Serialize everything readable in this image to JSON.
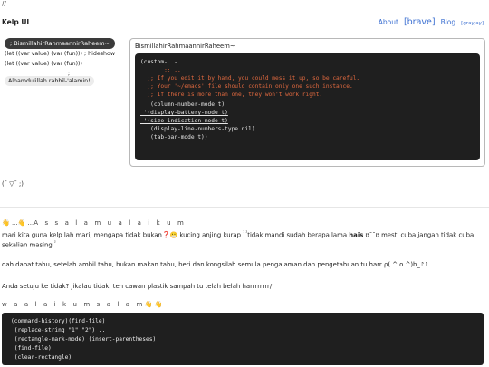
{
  "header": {
    "slashes": "//",
    "brand": "Kelp UI",
    "nav": {
      "about": "About",
      "brave": "[brave]",
      "blog": "Blog",
      "grayjay": "[grayjay]"
    }
  },
  "bubbles": {
    "title": "; BismillahirRahmaannirRaheem~",
    "line1": "(let ((var value) (var (fun))) ; hideshow",
    "line2": "(let ((var value) (var (fun)))",
    "semicolon": ";",
    "footer": "Alhamdulillah rabbil-'alamin!"
  },
  "card": {
    "title": "BismillahirRahmaannirRaheem~",
    "code": [
      "(custom-..-",
      "       ;; ..",
      "  ;; If you edit it by hand, you could mess it up, so be careful.",
      "  ;; Your '~/emacs' file should contain only one such instance.",
      "  ;; If there is more than one, they won't work right.",
      "  '(column-number-mode t)",
      " '(display-battery-mode t)",
      " '(size-indication-mode t)",
      "  '(display-line-numbers-type nil)",
      "  '(tab-bar-mode t))"
    ]
  },
  "kaomoji": "(¯ ▽¯ ;)",
  "salam1": {
    "emoji": "👋 ...👋 ... ",
    "text": "A s s a l a m u a l a i k u m"
  },
  "para1": {
    "a": "mari kita guna kelp lah mari, mengapa tidak bukan",
    "q": "❓",
    "b": " kucing anjing kurap ",
    "sup1": "⁷ ²",
    "c": "tidak mandi sudah berapa lama ",
    "bold": "hais",
    "d": " ʊ¯¯ʊ mesti cuba jangan tidak cuba sekalian masing ",
    "sup2": "²"
  },
  "para2": "dah dapat tahu, setelah ambil tahu, bukan makan tahu, beri dan kongsilah semula pengalaman dan pengetahuan tu harr ρ( ^ o ^)b_♪♪",
  "para3": "Anda setuju ke tidak? Jikalau tidak, teh cawan plastik sampah tu telah belah harrrrrrrr/",
  "salam2": {
    "text": "w a a l a i k u m s a l a m",
    "emoji": " 👋 👋"
  },
  "code2": [
    "(command-history)(find-file)",
    " (replace-string \"1\" \"2\") ..",
    " (rectangle-mark-mode) (insert-parentheses)",
    " (find-file)",
    " (clear-rectangle)"
  ]
}
